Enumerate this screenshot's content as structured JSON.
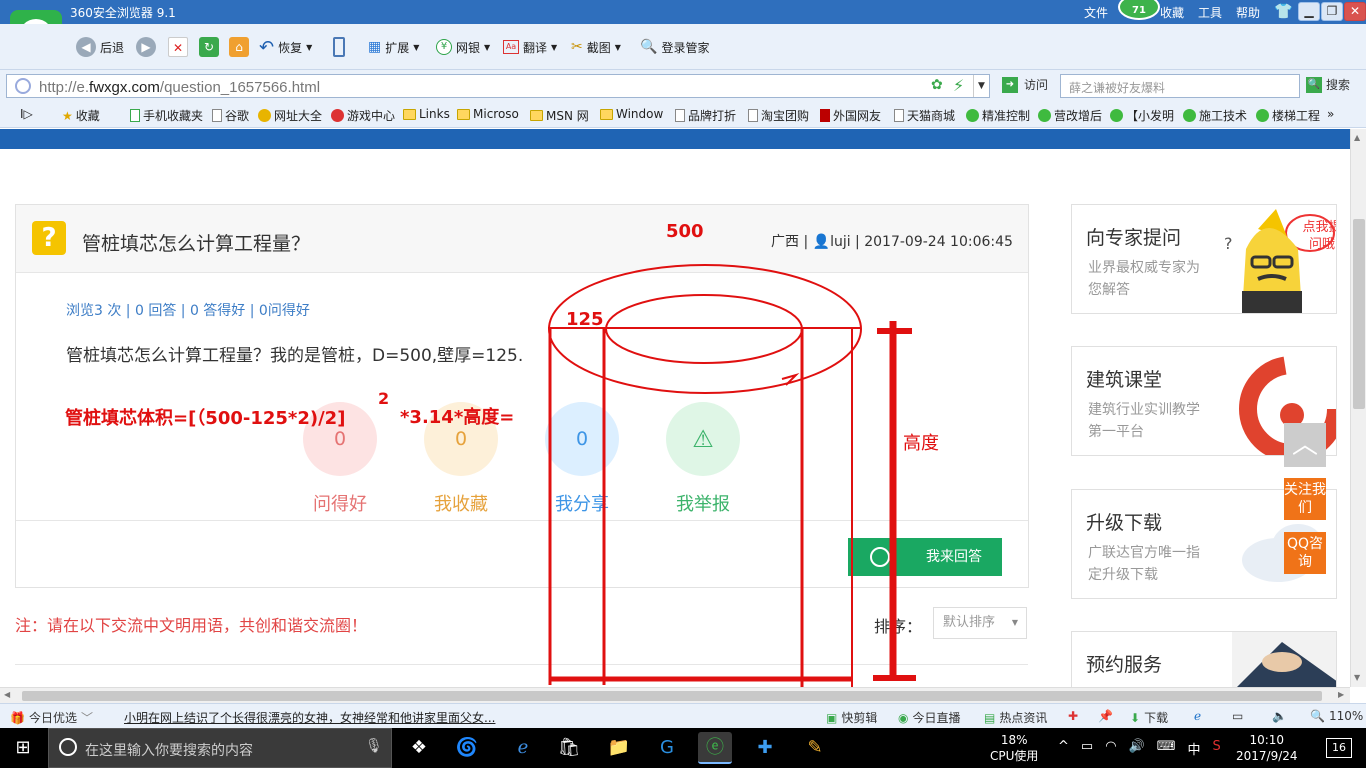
{
  "browser": {
    "title": "360安全浏览器 9.1",
    "menu": [
      "文件",
      "收藏",
      "工具",
      "帮助"
    ],
    "badge": "71",
    "toolbar": {
      "back": "后退",
      "restore": "恢复",
      "extend": "扩展",
      "bank": "网银",
      "translate": "翻译",
      "screenshot": "截图",
      "manager": "登录管家"
    },
    "url_prefix": "http://e.",
    "url_domain": "fwxgx.com",
    "url_path": "/question_1657566.html",
    "visit": "访问",
    "search_placeholder": "薛之谦被好友爆料",
    "search": "搜索",
    "bookmarks": [
      "收藏",
      "手机收藏夹",
      "谷歌",
      "网址大全",
      "游戏中心",
      "Links",
      "Microso",
      "MSN 网",
      "Window",
      "品牌打折",
      "淘宝团购",
      "外国网友",
      "天猫商城",
      "精准控制",
      "营改增后",
      "【小发明",
      "施工技术",
      "楼梯工程"
    ]
  },
  "question": {
    "title": "管桩填芯怎么计算工程量？",
    "region": "广西",
    "user": "luji",
    "time": "2017-09-24 10:06:45",
    "stats": "浏览3 次 | 0 回答 | 0 答得好 | 0问得好",
    "body": "管桩填芯怎么计算工程量？我的是管桩，D=500,壁厚=125.",
    "actions": [
      {
        "label": "问得好",
        "count": "0",
        "bg": "#fde3e3",
        "fg": "#e57373"
      },
      {
        "label": "我收藏",
        "count": "0",
        "bg": "#fdf0d9",
        "fg": "#e6a23c"
      },
      {
        "label": "我分享",
        "count": "0",
        "bg": "#dcefff",
        "fg": "#3d95e6"
      },
      {
        "label": "我举报",
        "count": "",
        "bg": "#dff6e6",
        "fg": "#3cb36b"
      }
    ],
    "answer": "我来回答",
    "note": "注：请在以下交流中文明用语，共创和谐交流圈！",
    "sort_label": "排序：",
    "sort_value": "默认排序"
  },
  "sidebar": {
    "cards": [
      {
        "title": "向专家提问",
        "sub": "业界最权威专家为您解答",
        "bubble": "点我提问哦"
      },
      {
        "title": "建筑课堂",
        "sub": "建筑行业实训教学第一平台"
      },
      {
        "title": "升级下载",
        "sub": "广联达官方唯一指定升级下载"
      },
      {
        "title": "预约服务",
        "sub": ""
      }
    ],
    "follow": "关注我们",
    "qq": "QQ咨询"
  },
  "annotations": {
    "d": "500",
    "t": "125",
    "formula": "管桩填芯体积=[（500-125*2)/2]",
    "exp": "2",
    "formula2": "*3.14*高度=",
    "height": "高度"
  },
  "statusbar": {
    "today": "今日优选",
    "news": "小明在网上结识了个长得很漂亮的女神，女神经常和他讲家里面父女...",
    "items": [
      "快剪辑",
      "今日直播",
      "热点资讯",
      "下载"
    ],
    "zoom": "110%"
  },
  "taskbar": {
    "search_placeholder": "在这里输入你要搜索的内容",
    "cpu": "18%",
    "cpu_label": "CPU使用",
    "ime": "中",
    "time": "10:10",
    "date": "2017/9/24",
    "notif": "16"
  },
  "colors": {
    "accent": "#1f64b4",
    "green": "#1aa862",
    "annotation": "#e01010"
  }
}
